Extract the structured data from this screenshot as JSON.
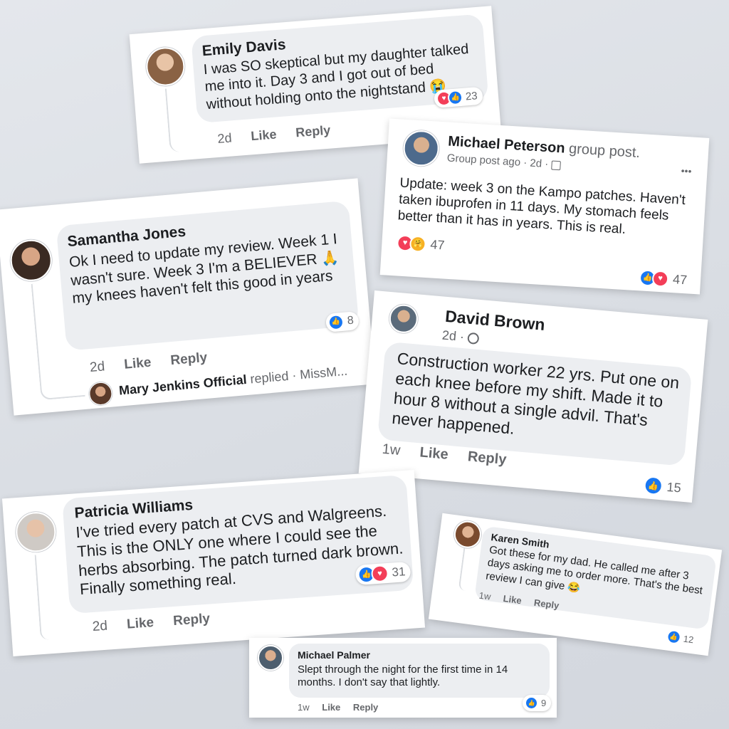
{
  "cards": {
    "emily": {
      "name": "Emily Davis",
      "text": "I was SO skeptical but my daughter talked me into it. Day 3 and I got out of bed without holding onto the nightstand",
      "emoji": "😭",
      "time": "2d",
      "like": "Like",
      "reply": "Reply",
      "reaction_count": "23"
    },
    "michael_peterson": {
      "name": "Michael Peterson",
      "name_suffix": "group post.",
      "meta": "Group post ago · 2d ·",
      "text": "Update: week 3 on the Kampo patches. Haven't taken ibuprofen in 11 days. My stomach feels better than it has in years. This is real.",
      "reaction_count_top": "47",
      "reaction_count_bottom": "47",
      "more": "•••"
    },
    "samantha": {
      "name": "Samantha Jones",
      "text": "Ok I need to update my review. Week 1 I wasn't sure. Week 3 I'm a BELIEVER",
      "emoji": "🙏",
      "text_end": "my knees haven't felt this good in years",
      "time": "2d",
      "like": "Like",
      "reply": "Reply",
      "reaction_count": "8",
      "reply_author": "Mary Jenkins Official",
      "reply_tail": "replied · MissM..."
    },
    "david": {
      "name": "David Brown",
      "meta": "2d ·",
      "text": "Construction worker 22 yrs. Put one on each knee before my shift. Made it to hour 8 without a single advil. That's never happened.",
      "time": "1w",
      "like": "Like",
      "reply": "Reply",
      "reaction_count": "15"
    },
    "patricia": {
      "name": "Patricia Williams",
      "text": "I've tried every patch at CVS and Walgreens.  This is the ONLY one where I could see the herbs absorbing. The patch turned dark brown. Finally something real.",
      "time": "2d",
      "like": "Like",
      "reply": "Reply",
      "reaction_count": "31"
    },
    "karen": {
      "name": "Karen Smith",
      "text": "Got these for my dad. He called me after 3 days asking me to order more. That's the best review I can give",
      "emoji": "😂",
      "time": "1w",
      "like": "Like",
      "reply": "Reply",
      "reaction_count": "12"
    },
    "michael_palmer": {
      "name": "Michael Palmer",
      "text": "Slept through the night for the first time in 14 months. I don't say that lightly.",
      "time": "1w",
      "like": "Like",
      "reply": "Reply",
      "reaction_count": "9"
    }
  },
  "colors": {
    "like_blue": "#1877f2",
    "love_red": "#f33e58",
    "bubble_gray": "#eceef1",
    "meta_gray": "#65676b"
  }
}
